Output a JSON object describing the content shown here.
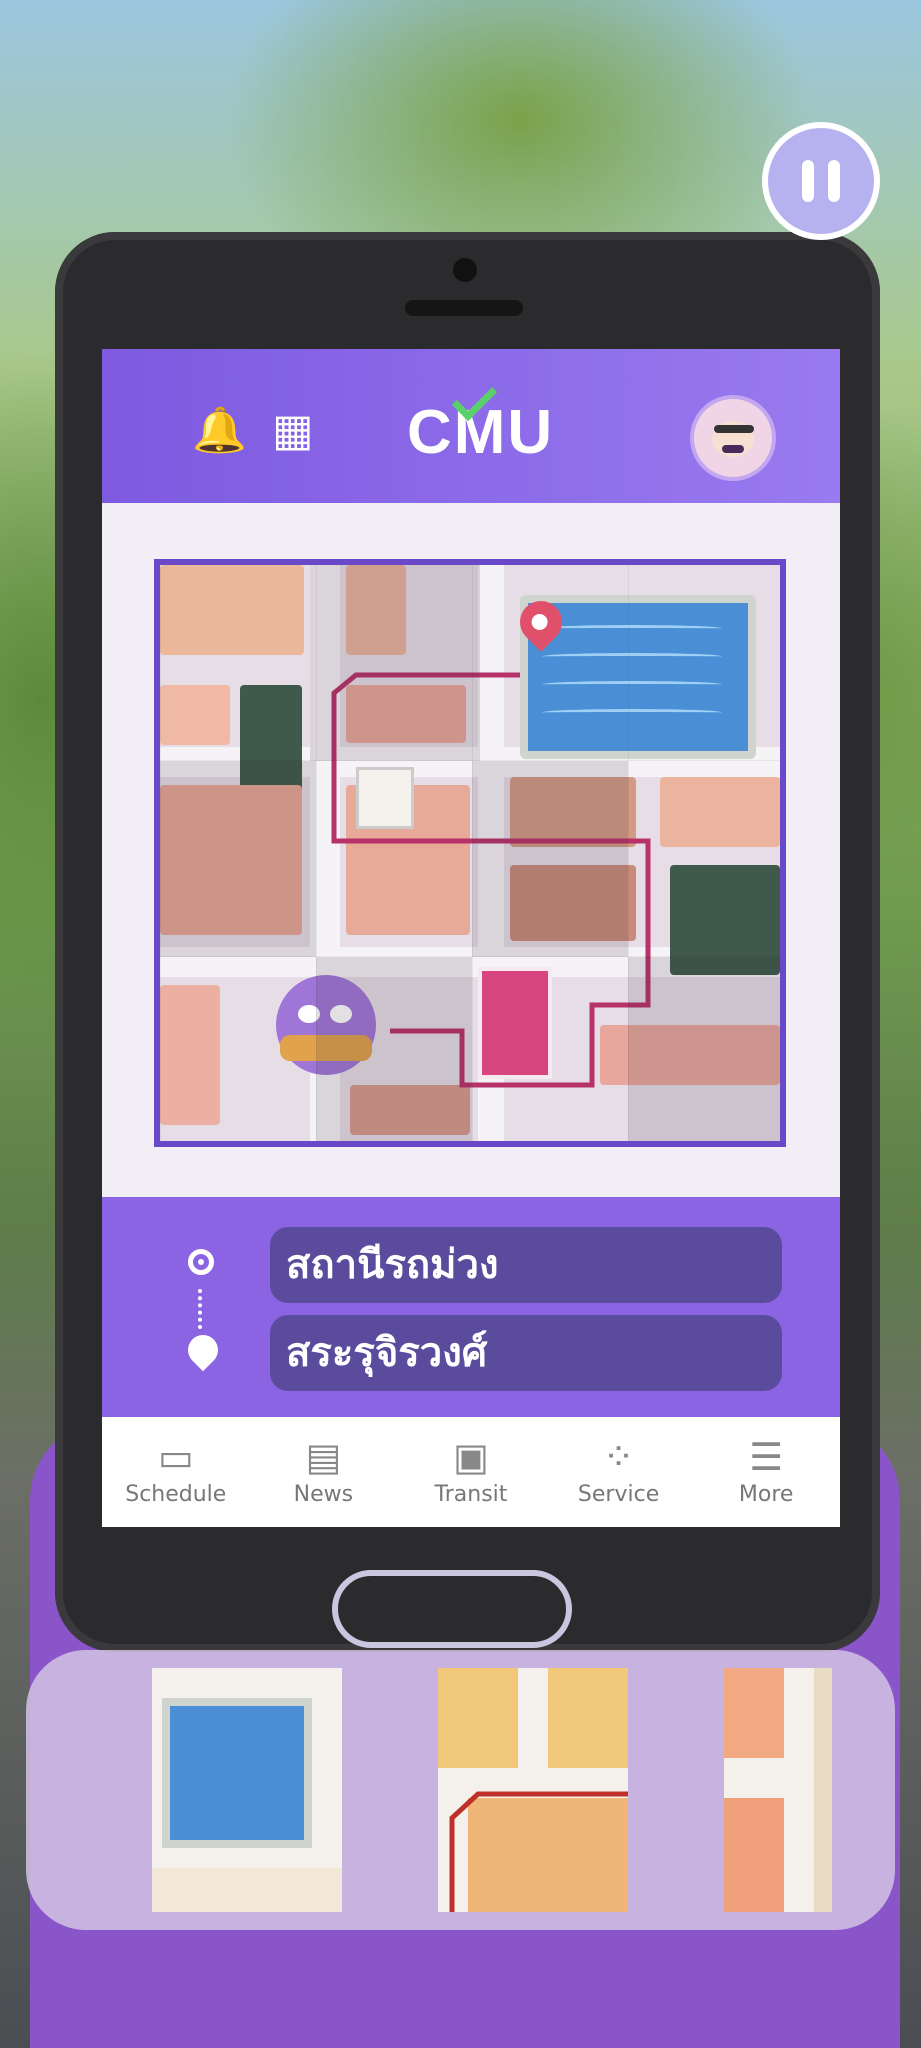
{
  "game": {
    "pause_icon": "pause-icon"
  },
  "app": {
    "header": {
      "logo": "CMU",
      "bell_icon": "bell-icon",
      "qr_icon": "qr-code-icon",
      "avatar_icon": "avatar"
    },
    "route": {
      "origin": "สถานีรถม่วง",
      "destination": "สระรุจิรวงศ์"
    },
    "nav": [
      {
        "label": "Schedule",
        "icon": "calendar-icon"
      },
      {
        "label": "News",
        "icon": "newspaper-icon"
      },
      {
        "label": "Transit",
        "icon": "bus-icon"
      },
      {
        "label": "Service",
        "icon": "apps-icon"
      },
      {
        "label": "More",
        "icon": "menu-icon"
      }
    ]
  },
  "colors": {
    "header": "#8a64e2",
    "stop_bg": "#5a4b9c",
    "route_line": "#b8326a",
    "pin": "#e0506a"
  }
}
